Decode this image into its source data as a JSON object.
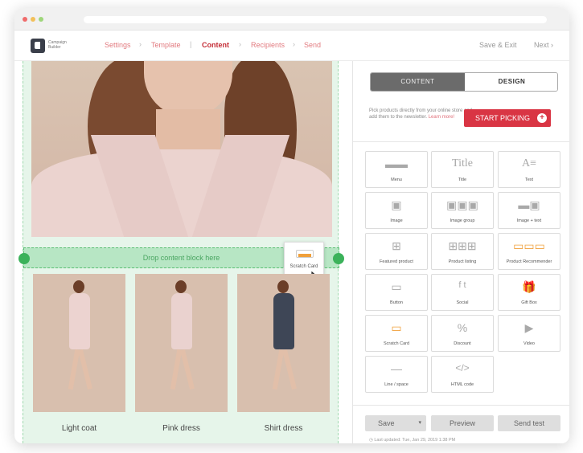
{
  "nav": {
    "logo_text": "Campaign Builder",
    "steps": [
      "Settings",
      "Template",
      "Content",
      "Recipients",
      "Send"
    ],
    "active_step": "Content",
    "save_exit": "Save & Exit",
    "next": "Next"
  },
  "canvas": {
    "drop_text": "Drop content block here",
    "drag_card_label": "Scratch Card",
    "products": [
      {
        "name": "Light coat"
      },
      {
        "name": "Pink dress"
      },
      {
        "name": "Shirt dress"
      }
    ]
  },
  "sidebar": {
    "tabs": [
      "CONTENT",
      "DESIGN"
    ],
    "hint": "Pick products directly from your online store and add them to the newsletter.",
    "hint_link": "Learn more!",
    "start_button": "START PICKING",
    "blocks": [
      {
        "label": "Menu",
        "icon": "menu-icon"
      },
      {
        "label": "Title",
        "icon": "title-icon"
      },
      {
        "label": "Text",
        "icon": "text-icon"
      },
      {
        "label": "Image",
        "icon": "image-icon"
      },
      {
        "label": "Image group",
        "icon": "image-group-icon"
      },
      {
        "label": "Image + text",
        "icon": "image-text-icon"
      },
      {
        "label": "Featured product",
        "icon": "featured-product-icon"
      },
      {
        "label": "Product listing",
        "icon": "product-listing-icon"
      },
      {
        "label": "Product Recommender",
        "icon": "product-recommender-icon"
      },
      {
        "label": "Button",
        "icon": "button-icon"
      },
      {
        "label": "Social",
        "icon": "social-icon"
      },
      {
        "label": "Gift Box",
        "icon": "gift-box-icon"
      },
      {
        "label": "Scratch Card",
        "icon": "scratch-card-icon"
      },
      {
        "label": "Discount",
        "icon": "discount-icon"
      },
      {
        "label": "Video",
        "icon": "video-icon"
      },
      {
        "label": "Line / space",
        "icon": "line-space-icon"
      },
      {
        "label": "HTML code",
        "icon": "html-code-icon"
      }
    ],
    "footer": {
      "save": "Save",
      "preview": "Preview",
      "send_test": "Send test",
      "last_updated": "Last updated: Tue, Jan 29, 2019 1:38 PM"
    }
  },
  "colors": {
    "accent": "#d93544",
    "drop_zone": "#b7e6c4",
    "canvas_bg": "#e6f5ea"
  }
}
